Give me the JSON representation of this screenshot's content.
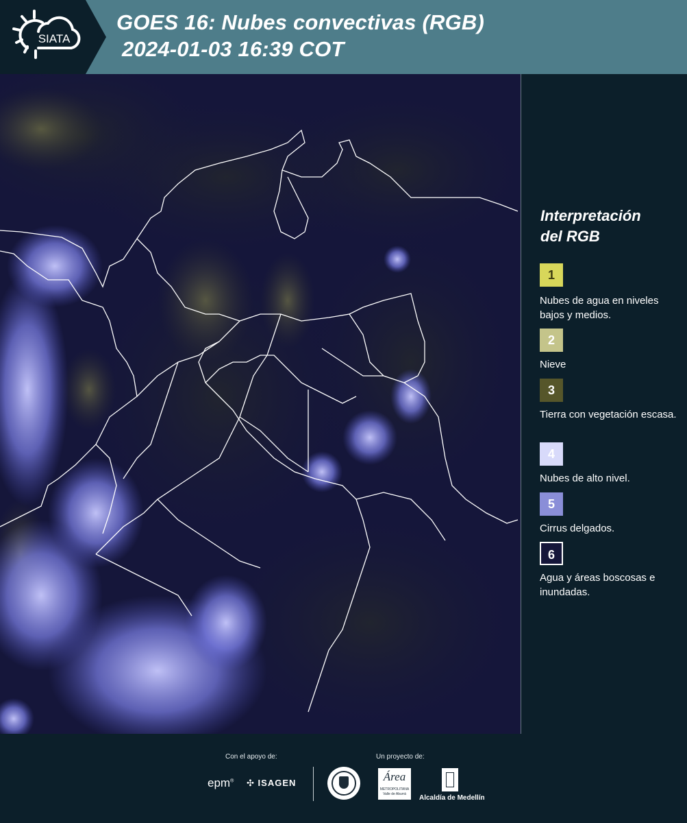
{
  "header": {
    "logo_text": "SIATA",
    "title_line1": "GOES 16: Nubes convectivas (RGB)",
    "title_line2": "2024-01-03 16:39 COT"
  },
  "map": {
    "type": "satellite-rgb",
    "background_color": "#15163a",
    "border_color": "#ffffff",
    "cloud_color": "#8a8cf0",
    "vegetation_color": "#8a8a4a"
  },
  "legend": {
    "title_line1": "Interpretación",
    "title_line2": "del RGB",
    "items": [
      {
        "number": "1",
        "label": "Nubes de agua en niveles bajos y medios.",
        "color": "#d8d75a",
        "text_color": "#3b3a10"
      },
      {
        "number": "2",
        "label": "Nieve",
        "color": "#c4c48a",
        "text_color": "#ffffff"
      },
      {
        "number": "3",
        "label": "Tierra con vegetación escasa.",
        "color": "#56562a",
        "text_color": "#ffffff"
      },
      {
        "number": "4",
        "label": "Nubes de alto nivel.",
        "color": "#d8dafa",
        "text_color": "#ffffff"
      },
      {
        "number": "5",
        "label": "Cirrus delgados.",
        "color": "#8a8ed8",
        "text_color": "#ffffff"
      },
      {
        "number": "6",
        "label": "Agua y áreas boscosas e inundadas.",
        "color": "#15163a",
        "text_color": "#ffffff"
      }
    ]
  },
  "footer": {
    "support_label": "Con el apoyo de:",
    "project_label": "Un proyecto de:",
    "sponsors": [
      "epm",
      "ISAGEN"
    ],
    "partners": {
      "metro_name": "Área",
      "metro_line1": "METROPOLITANA",
      "metro_line2": "Valle de Aburrá",
      "alcaldia": "Alcaldía de Medellín"
    }
  }
}
